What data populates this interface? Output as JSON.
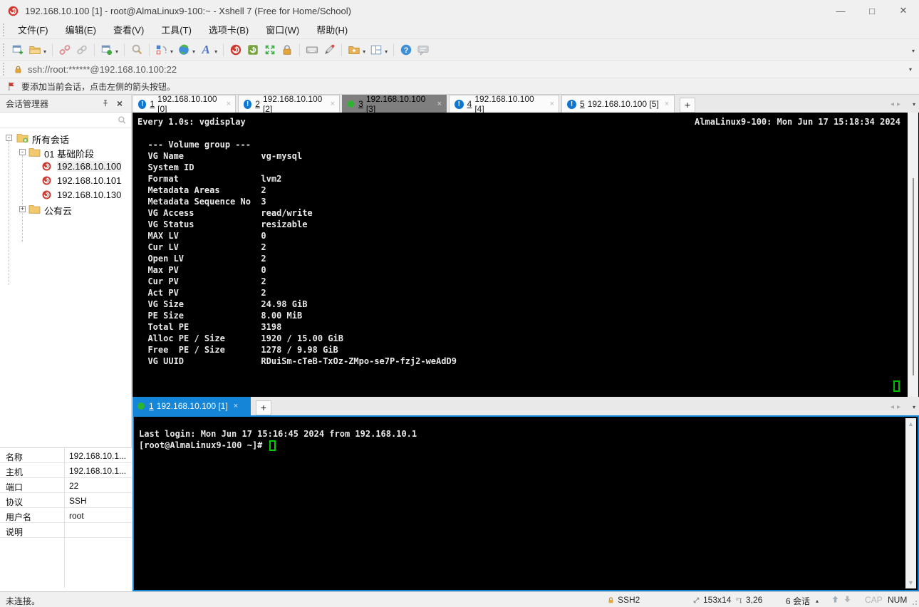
{
  "window": {
    "title": "192.168.10.100 [1] - root@AlmaLinux9-100:~ - Xshell 7 (Free for Home/School)",
    "minimize": "—",
    "maximize": "□",
    "close": "✕"
  },
  "menu": {
    "items": [
      "文件(F)",
      "编辑(E)",
      "查看(V)",
      "工具(T)",
      "选项卡(B)",
      "窗口(W)",
      "帮助(H)"
    ]
  },
  "toolbar": {
    "icons": [
      "new-session-icon",
      "open-session-icon",
      "disconnect-icon",
      "reconnect-icon",
      "session-properties-icon",
      "find-icon",
      "compose-pane-icon",
      "web-browser-icon",
      "font-icon",
      "xshell-logo-icon",
      "xftp-logo-icon",
      "fullscreen-icon",
      "lock-screen-icon",
      "virtual-keyboard-icon",
      "highlight-pen-icon",
      "new-transfer-icon",
      "tile-layout-icon",
      "help-icon",
      "feedback-icon"
    ]
  },
  "addressbar": {
    "url": "ssh://root:******@192.168.10.100:22"
  },
  "noticebar": {
    "text": "要添加当前会话，点击左侧的箭头按钮。"
  },
  "sidebar": {
    "title": "会话管理器",
    "close_glyph": "×",
    "tree": [
      {
        "label": "所有会话",
        "type": "root-folder",
        "expander": "-"
      },
      {
        "label": "01 基础阶段",
        "type": "folder",
        "expander": "-"
      },
      {
        "label": "192.168.10.100",
        "type": "session"
      },
      {
        "label": "192.168.10.101",
        "type": "session"
      },
      {
        "label": "192.168.10.130",
        "type": "session"
      },
      {
        "label": "公有云",
        "type": "folder",
        "expander": "+"
      }
    ],
    "properties": [
      {
        "label": "名称",
        "value": "192.168.10.1..."
      },
      {
        "label": "主机",
        "value": "192.168.10.1..."
      },
      {
        "label": "端口",
        "value": "22"
      },
      {
        "label": "协议",
        "value": "SSH"
      },
      {
        "label": "用户名",
        "value": "root"
      },
      {
        "label": "说明",
        "value": ""
      }
    ]
  },
  "tabs": {
    "top": [
      {
        "num": "1",
        "label": "192.168.10.100 [0]",
        "status": "alert",
        "close": "×"
      },
      {
        "num": "2",
        "label": "192.168.10.100 [2]",
        "status": "alert",
        "close": "×"
      },
      {
        "num": "3",
        "label": "192.168.10.100 [3]",
        "status": "connected",
        "close": "×"
      },
      {
        "num": "4",
        "label": "192.168.10.100 [4]",
        "status": "alert",
        "close": "×"
      },
      {
        "num": "5",
        "label": "192.168.10.100 [5]",
        "status": "alert",
        "close": "×"
      }
    ],
    "bottom": [
      {
        "num": "1",
        "label": "192.168.10.100 [1]",
        "status": "connected",
        "close": "×"
      }
    ],
    "add_label": "+",
    "scroll_left": "◂",
    "scroll_right": "▸",
    "menu_caret": "▾"
  },
  "top_terminal": {
    "header_left": "Every 1.0s: vgdisplay",
    "header_right": "AlmaLinux9-100: Mon Jun 17 15:18:34 2024",
    "lines": [
      "",
      "  --- Volume group ---",
      "  VG Name               vg-mysql",
      "  System ID",
      "  Format                lvm2",
      "  Metadata Areas        2",
      "  Metadata Sequence No  3",
      "  VG Access             read/write",
      "  VG Status             resizable",
      "  MAX LV                0",
      "  Cur LV                2",
      "  Open LV               2",
      "  Max PV                0",
      "  Cur PV                2",
      "  Act PV                2",
      "  VG Size               24.98 GiB",
      "  PE Size               8.00 MiB",
      "  Total PE              3198",
      "  Alloc PE / Size       1920 / 15.00 GiB",
      "  Free  PE / Size       1278 / 9.98 GiB",
      "  VG UUID               RDuiSm-cTeB-TxOz-ZMpo-se7P-fzj2-weAdD9"
    ]
  },
  "bottom_terminal": {
    "lines": [
      "Last login: Mon Jun 17 15:16:45 2024 from 192.168.10.1"
    ],
    "prompt": "[root@AlmaLinux9-100 ~]# "
  },
  "statusbar": {
    "left": "未连接。",
    "protocol": "SSH2",
    "size": "153x14",
    "position": "3,26",
    "sessions": "6 会话",
    "cap": "CAP",
    "num": "NUM"
  },
  "colors": {
    "accent_blue": "#1585d8",
    "terminal_green": "#00cc00",
    "tab_alert_blue": "#0d77d1",
    "connected_green": "#2cb52c",
    "xshell_red": "#ce3a31",
    "lock_gold": "#e2a83d"
  }
}
